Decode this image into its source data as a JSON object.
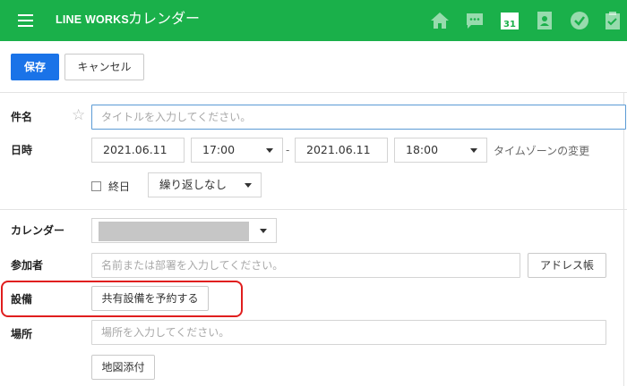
{
  "header": {
    "brand": "LINE WORKS",
    "title": "カレンダー",
    "calendar_icon_day": "31",
    "bg_color": "#1ab04a"
  },
  "toolbar": {
    "save_label": "保存",
    "cancel_label": "キャンセル",
    "primary_color": "#1a73e8"
  },
  "form": {
    "subject_label": "件名",
    "subject_placeholder": "タイトルを入力してください。",
    "datetime_label": "日時",
    "start_date": "2021.06.11",
    "start_time": "17:00",
    "end_date": "2021.06.11",
    "end_time": "18:00",
    "timezone_link": "タイムゾーンの変更",
    "allday_label": "終日",
    "repeat_value": "繰り返しなし",
    "calendar_label": "カレンダー",
    "participants_label": "参加者",
    "participants_placeholder": "名前または部署を入力してください。",
    "address_book_label": "アドレス帳",
    "facility_label": "設備",
    "facility_button": "共有設備を予約する",
    "location_label": "場所",
    "location_placeholder": "場所を入力してください。",
    "map_button": "地図添付"
  },
  "highlight_color": "#e01e1e"
}
